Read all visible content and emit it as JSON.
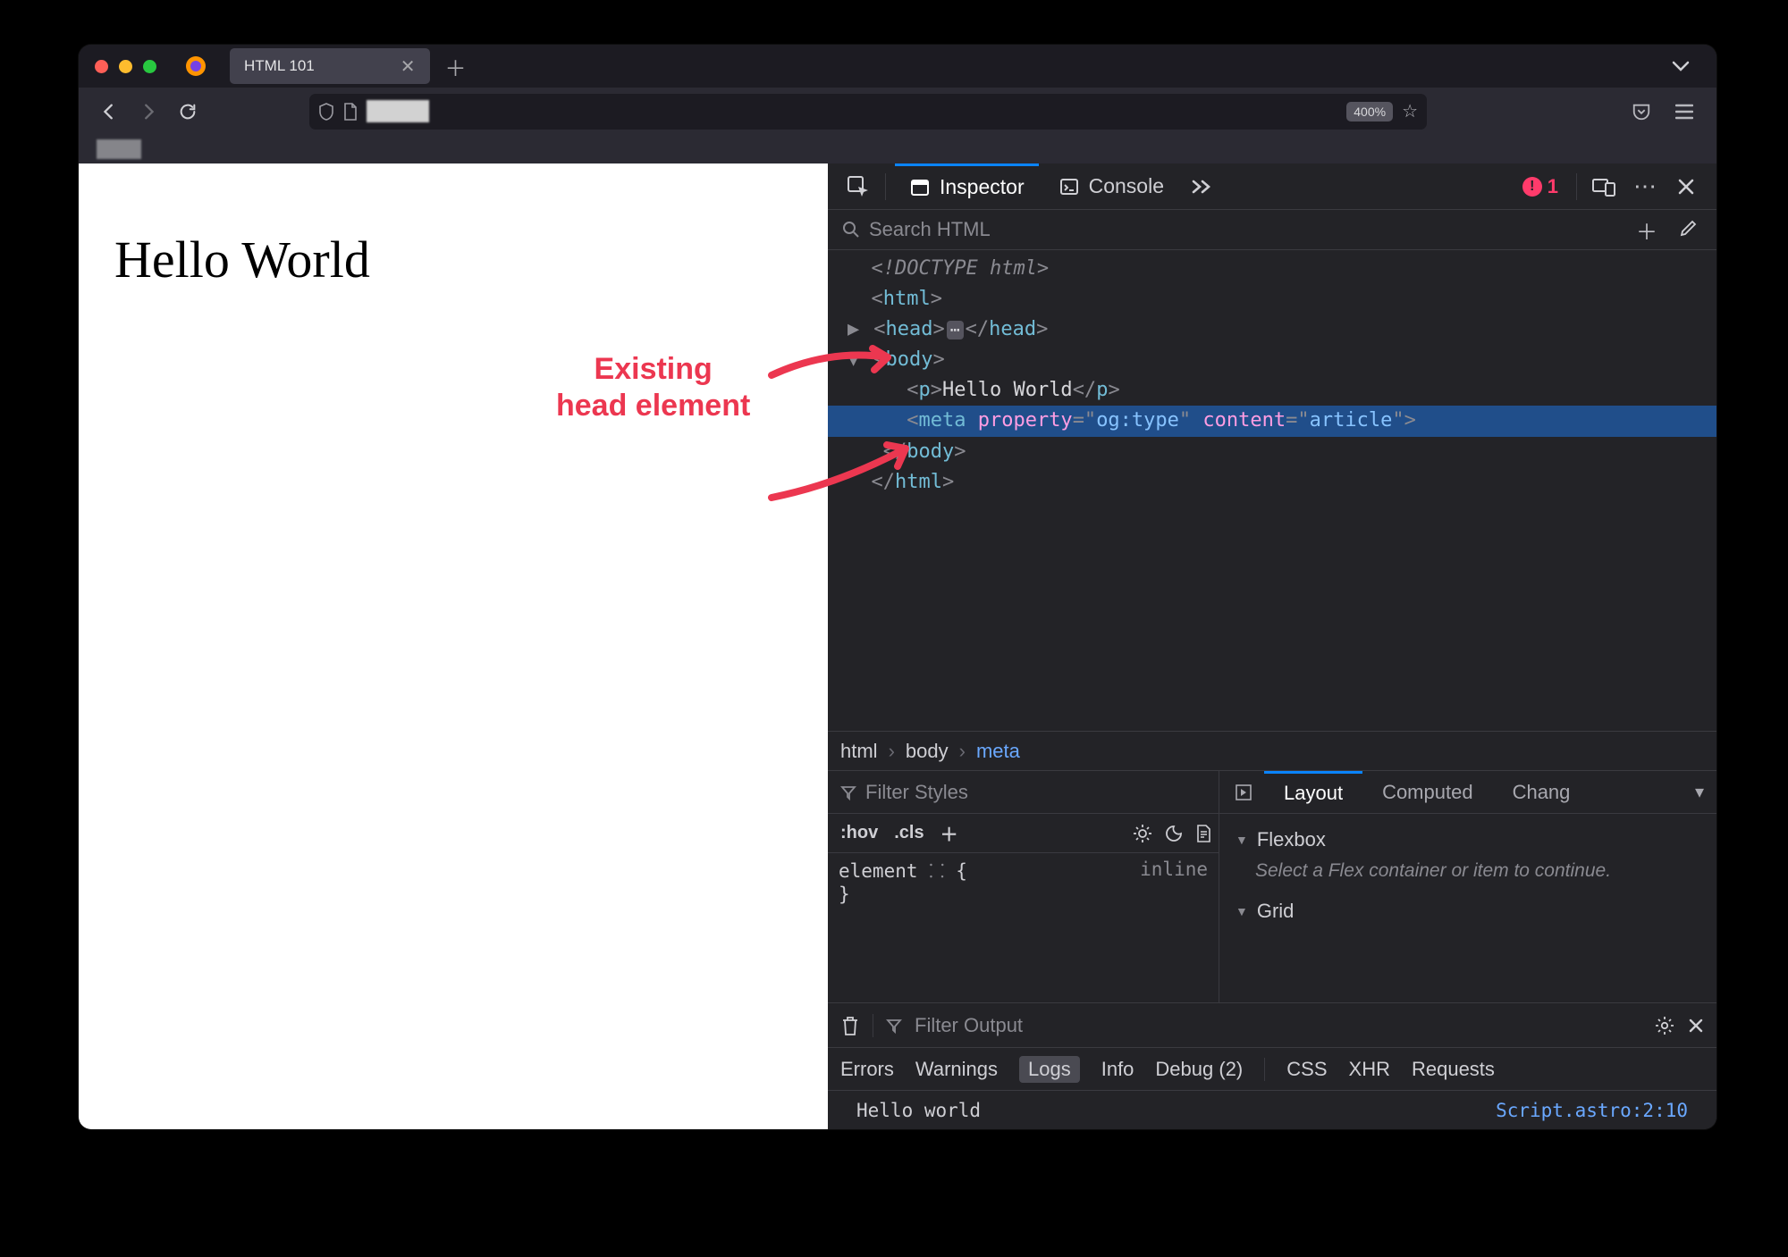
{
  "tab": {
    "title": "HTML 101"
  },
  "toolbar": {
    "zoom": "400%"
  },
  "page": {
    "heading": "Hello World"
  },
  "annotation": {
    "line1": "Existing",
    "line2": "head element"
  },
  "devtools": {
    "tabs": {
      "inspector": "Inspector",
      "console": "Console"
    },
    "error_count": "1",
    "search_placeholder": "Search HTML",
    "dom": {
      "doctype": "<!DOCTYPE html>",
      "html_open": "html",
      "head": "head",
      "body": "body",
      "p_text": "Hello World",
      "meta_property": "og:type",
      "meta_content": "article"
    },
    "breadcrumb": {
      "a": "html",
      "b": "body",
      "c": "meta"
    },
    "styles": {
      "filter_placeholder": "Filter Styles",
      "hov": ":hov",
      "cls": ".cls",
      "element_label": "element",
      "brace_open": "{",
      "brace_close": "}",
      "inline_label": "inline"
    },
    "layout": {
      "tabs": {
        "layout": "Layout",
        "computed": "Computed",
        "changes": "Chang"
      },
      "flexbox": "Flexbox",
      "flexbox_hint": "Select a Flex container or item to continue.",
      "grid": "Grid"
    },
    "console": {
      "filter_placeholder": "Filter Output",
      "filters": {
        "errors": "Errors",
        "warnings": "Warnings",
        "logs": "Logs",
        "info": "Info",
        "debug": "Debug (2)",
        "css": "CSS",
        "xhr": "XHR",
        "requests": "Requests"
      },
      "msg": "Hello world",
      "src": "Script.astro:2:10"
    }
  }
}
